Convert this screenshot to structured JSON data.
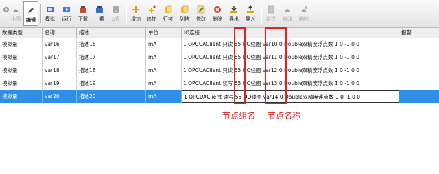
{
  "toolbar": {
    "buttons": [
      {
        "label": "",
        "icon": "gear-icon",
        "enabled": false
      },
      {
        "label": "小图",
        "icon": "small-icons-icon",
        "enabled": false
      },
      {
        "label": "编辑",
        "icon": "pencil-icon",
        "enabled": true,
        "active": true
      },
      {
        "label": "模拟",
        "icon": "simulate-icon",
        "enabled": true
      },
      {
        "label": "运行",
        "icon": "run-icon",
        "enabled": true
      },
      {
        "label": "下载",
        "icon": "download-icon",
        "enabled": true
      },
      {
        "label": "上载",
        "icon": "upload-icon",
        "enabled": true
      },
      {
        "label": "U盘",
        "icon": "usb-icon",
        "enabled": false
      },
      {
        "label": "增加",
        "icon": "add-icon",
        "enabled": true
      },
      {
        "label": "追加",
        "icon": "append-icon",
        "enabled": true
      },
      {
        "label": "行拷",
        "icon": "row-copy-icon",
        "enabled": true
      },
      {
        "label": "列拷",
        "icon": "column-copy-icon",
        "enabled": true
      },
      {
        "label": "修改",
        "icon": "edit-icon",
        "enabled": true
      },
      {
        "label": "删除",
        "icon": "delete-icon",
        "enabled": true
      },
      {
        "label": "导出",
        "icon": "export-icon",
        "enabled": true
      },
      {
        "label": "导入",
        "icon": "import-icon",
        "enabled": true
      },
      {
        "label": "新建",
        "icon": "new-icon",
        "enabled": false
      },
      {
        "label": "修改",
        "icon": "modify-icon",
        "enabled": false
      },
      {
        "label": "删除",
        "icon": "remove-icon",
        "enabled": false
      }
    ]
  },
  "table": {
    "columns": [
      "数据类型",
      "名称",
      "描述",
      "单位",
      "IO连接",
      "报警"
    ],
    "rows": [
      {
        "type": "模拟量",
        "name": "var16",
        "desc": "描述16",
        "unit": "mA",
        "io": "1 OPCUAClient 只读 55 DO线圈 var10 0 Double双精度浮点数 1 0 -1 0 0",
        "selected": false
      },
      {
        "type": "模拟量",
        "name": "var17",
        "desc": "描述17",
        "unit": "mA",
        "io": "1 OPCUAClient 只读 55 DO线圈 var11 0 Double双精度浮点数 1 0 -1 0 0",
        "selected": false
      },
      {
        "type": "模拟量",
        "name": "var18",
        "desc": "描述18",
        "unit": "mA",
        "io": "1 OPCUAClient 只读 55 DO线圈 var12 0 Double双精度浮点数 1 0 -1 0 0",
        "selected": false
      },
      {
        "type": "模拟量",
        "name": "var19",
        "desc": "描述19",
        "unit": "mA",
        "io": "1 OPCUAClient 读写 55 DO线圈 var13 0 Double双精度浮点数 1 0 -1 0 0",
        "selected": false
      },
      {
        "type": "模拟量",
        "name": "var20",
        "desc": "描述20",
        "unit": "mA",
        "io": "1 OPCUAClient 读写 55 DO线圈 var14 0 Double双精度浮点数 1 0 -1 0 0",
        "selected": true
      }
    ]
  },
  "annotations": {
    "node_group": "节点组名",
    "node_name": "节点名称"
  },
  "colors": {
    "selection": "#2f8fe6",
    "annotation_red": "#e52020"
  }
}
